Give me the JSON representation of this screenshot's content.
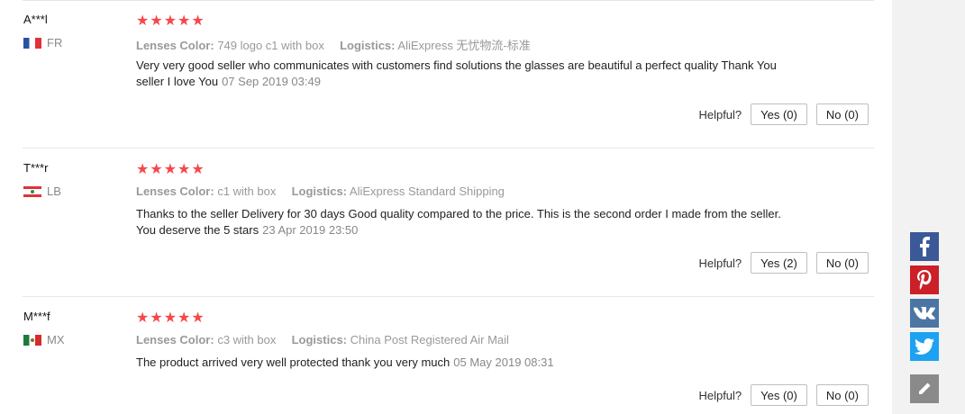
{
  "reviews": [
    {
      "user": "A***l",
      "country": "FR",
      "stars": "★★★★★",
      "attr1_key": "Lenses Color:",
      "attr1_val": "749 logo c1 with box",
      "attr2_key": "Logistics:",
      "attr2_val": "AliExpress 无忧物流-标准",
      "text": "Very very good seller who communicates with customers find solutions the glasses are beautiful a perfect quality Thank You seller I love You",
      "date": "07 Sep 2019 03:49",
      "helpful_label": "Helpful?",
      "yes": "Yes (0)",
      "no": "No (0)"
    },
    {
      "user": "T***r",
      "country": "LB",
      "stars": "★★★★★",
      "attr1_key": "Lenses Color:",
      "attr1_val": "c1 with box",
      "attr2_key": "Logistics:",
      "attr2_val": "AliExpress Standard Shipping",
      "text": "Thanks to the seller Delivery for 30 days Good quality compared to the price. This is the second order I made from the seller. You deserve the 5 stars",
      "date": "23 Apr 2019 23:50",
      "helpful_label": "Helpful?",
      "yes": "Yes (2)",
      "no": "No (0)"
    },
    {
      "user": "M***f",
      "country": "MX",
      "stars": "★★★★★",
      "attr1_key": "Lenses Color:",
      "attr1_val": "c3 with box",
      "attr2_key": "Logistics:",
      "attr2_val": "China Post Registered Air Mail",
      "text": "The product arrived very well protected thank you very much",
      "date": "05 May 2019 08:31",
      "helpful_label": "Helpful?",
      "yes": "Yes (0)",
      "no": "No (0)"
    }
  ],
  "share": {
    "facebook": {
      "icon": "facebook-icon",
      "color": "#3b5998"
    },
    "pinterest": {
      "icon": "pinterest-icon",
      "color": "#cb2027"
    },
    "vk": {
      "icon": "vk-icon",
      "color": "#4c75a3"
    },
    "twitter": {
      "icon": "twitter-icon",
      "color": "#1da1f2"
    },
    "edit": {
      "icon": "pencil-icon",
      "color": "#8a8a8a"
    }
  },
  "colors": {
    "star": "#f5484b"
  }
}
